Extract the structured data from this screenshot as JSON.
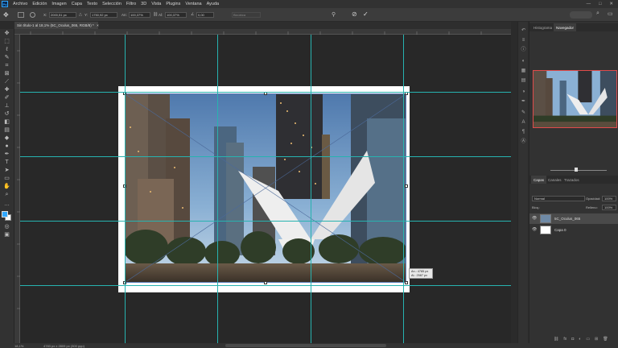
{
  "app": {
    "logo_text": "Ps"
  },
  "menu": [
    "Archivo",
    "Edición",
    "Imagen",
    "Capa",
    "Texto",
    "Selección",
    "Filtro",
    "3D",
    "Vista",
    "Plugins",
    "Ventana",
    "Ayuda"
  ],
  "window_controls": [
    "—",
    "□",
    "✕"
  ],
  "options_bar": {
    "x_label": "X:",
    "x_value": "2000,51 px",
    "y_label": "Y:",
    "y_value": "1750,92 px",
    "w_label": "An:",
    "w_value": "100,37%",
    "h_label": "Al:",
    "h_value": "100,37%",
    "angle_value": "0,00",
    "interp_value": "Bicúbica",
    "cancel_icon": "cancel-icon",
    "commit_icon": "checkmark-icon"
  },
  "document_tab": {
    "title": "Sin título-1 al 18,1% (5C_Oculus_065, RGB/8) *",
    "close": "×"
  },
  "transform_readout": {
    "width": "An.: 4785 px",
    "height": "Al.: 2587 px"
  },
  "status_bar": {
    "zoom": "18,1%",
    "doc_info": "4783 px x 2809 px (300 ppp)"
  },
  "panels": {
    "top_tabs": [
      "Histograma",
      "Navegador"
    ],
    "active_top_tab": "Navegador",
    "layer_tabs": [
      "Capas",
      "Canales",
      "Trazados"
    ],
    "active_layer_tab": "Capas",
    "blend_mode": "Normal",
    "opacity_label": "Opacidad:",
    "opacity_value": "100%",
    "lock_label": "Bloq.:",
    "fill_label": "Relleno:",
    "fill_value": "100%",
    "layers": [
      {
        "name": "5C_Oculus_065",
        "visible": true
      },
      {
        "name": "Capa 0",
        "visible": true
      }
    ]
  },
  "colors": {
    "guide": "#27b3b0",
    "foreground": "#31a8ff",
    "background": "#ffffff",
    "nav_frame": "#e04b4b"
  }
}
